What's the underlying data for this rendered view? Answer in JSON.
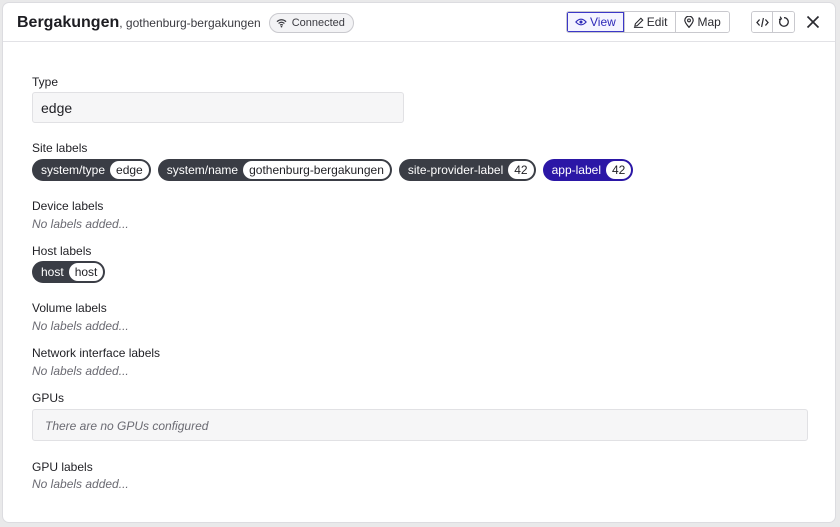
{
  "header": {
    "title": "Bergakungen",
    "subtitle": ", gothenburg-bergakungen",
    "status": "Connected",
    "modes": [
      {
        "label": "View",
        "icon": "eye-icon",
        "active": true
      },
      {
        "label": "Edit",
        "icon": "pencil-icon",
        "active": false
      },
      {
        "label": "Map",
        "icon": "map-pin-icon",
        "active": false
      }
    ],
    "tools": [
      "code-icon",
      "refresh-icon"
    ],
    "close_icon": "close-icon"
  },
  "type_section": {
    "label": "Type",
    "value": "edge"
  },
  "site_labels": {
    "label": "Site labels",
    "chips": [
      {
        "key": "system/type",
        "value": "edge",
        "accent": false
      },
      {
        "key": "system/name",
        "value": "gothenburg-bergakungen",
        "accent": false
      },
      {
        "key": "site-provider-label",
        "value": "42",
        "accent": false
      },
      {
        "key": "app-label",
        "value": "42",
        "accent": true
      }
    ]
  },
  "device_labels": {
    "label": "Device labels",
    "empty": "No labels added..."
  },
  "host_labels": {
    "label": "Host labels",
    "chips": [
      {
        "key": "host",
        "value": "host"
      }
    ]
  },
  "volume_labels": {
    "label": "Volume labels",
    "empty": "No labels added..."
  },
  "network_labels": {
    "label": "Network interface labels",
    "empty": "No labels added..."
  },
  "gpus": {
    "label": "GPUs",
    "empty": "There are no GPUs configured"
  },
  "gpu_labels": {
    "label": "GPU labels",
    "empty": "No labels added..."
  },
  "colors": {
    "accent": "#2b17a6",
    "chip": "#3a3d45",
    "active_mode": "#3b37c8"
  }
}
